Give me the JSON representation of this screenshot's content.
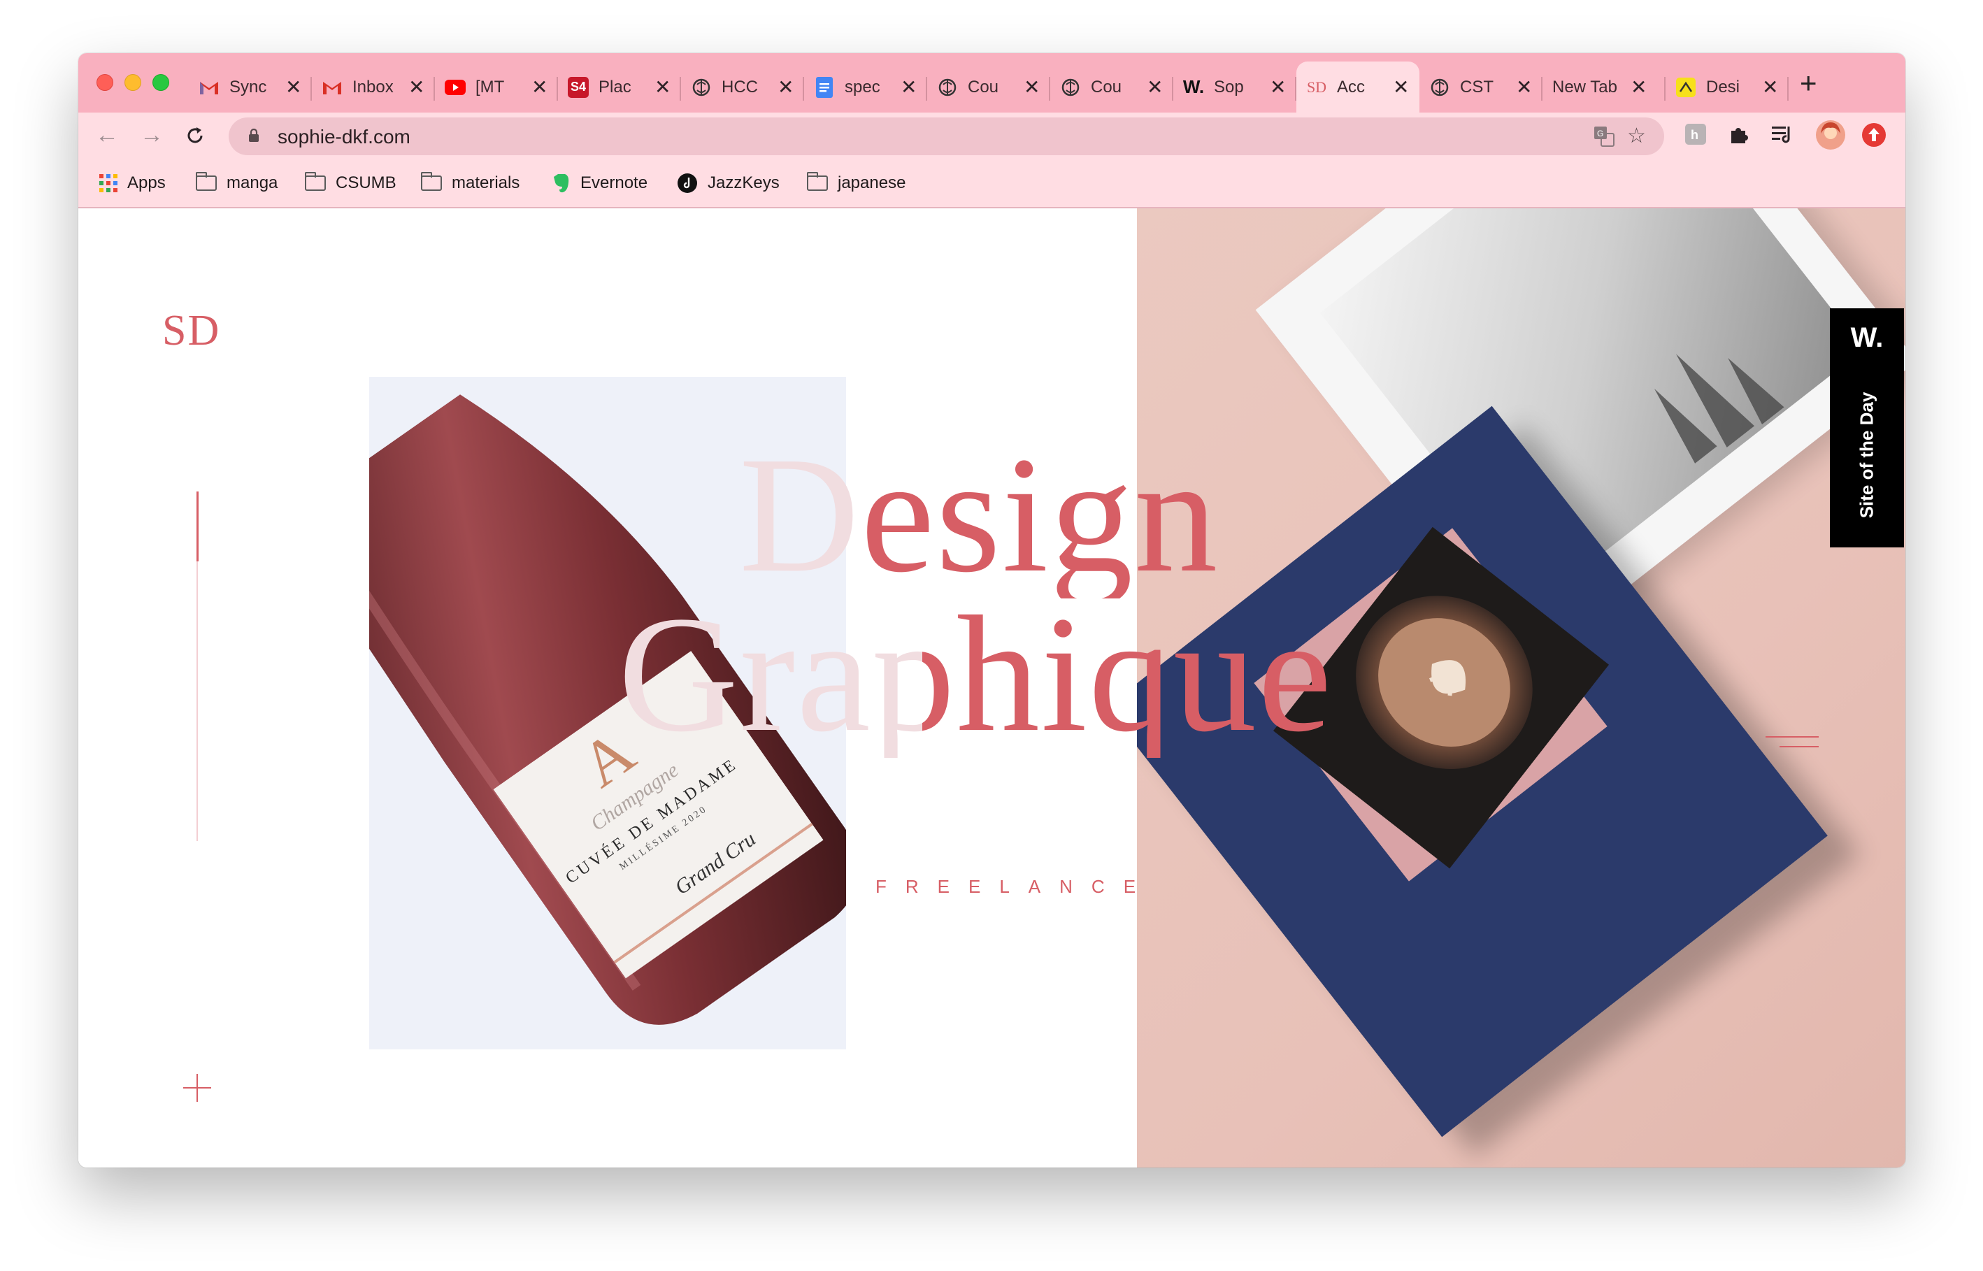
{
  "browser": {
    "tabs": [
      {
        "favicon": "gmail-icon",
        "title": "Sync"
      },
      {
        "favicon": "gmail-icon",
        "title": "Inbox"
      },
      {
        "favicon": "youtube-icon",
        "title": "[MT"
      },
      {
        "favicon": "s4-icon",
        "title": "Plac"
      },
      {
        "favicon": "brain-icon",
        "title": "HCC"
      },
      {
        "favicon": "docs-icon",
        "title": "spec"
      },
      {
        "favicon": "brain-icon",
        "title": "Cou"
      },
      {
        "favicon": "brain-icon",
        "title": "Cou"
      },
      {
        "favicon": "awwwards-icon",
        "title": "Sop"
      },
      {
        "favicon": "sd-icon",
        "title": "Acc",
        "active": true
      },
      {
        "favicon": "brain-icon",
        "title": "CST"
      },
      {
        "favicon": "",
        "title": "New Tab"
      },
      {
        "favicon": "design-icon",
        "title": "Desi"
      }
    ],
    "url": "sophie-dkf.com",
    "bookmarks": [
      {
        "icon": "apps-grid-icon",
        "label": "Apps"
      },
      {
        "icon": "folder-icon",
        "label": "manga"
      },
      {
        "icon": "folder-icon",
        "label": "CSUMB"
      },
      {
        "icon": "folder-icon",
        "label": "materials"
      },
      {
        "icon": "evernote-icon",
        "label": "Evernote"
      },
      {
        "icon": "jazzkeys-icon",
        "label": "JazzKeys"
      },
      {
        "icon": "folder-icon",
        "label": "japanese"
      }
    ],
    "accent_color": "#f9b0bf"
  },
  "page": {
    "logo": "SD",
    "headline_line1": "Design",
    "headline_line2": "Graphique",
    "tagline": "FREELANCE",
    "badge_mark": "W.",
    "badge_label": "Site of the Day",
    "brand_color": "#d75e65",
    "bottle_label": {
      "letter": "A",
      "script": "Champagne",
      "name": "CUVÉE DE MADAME",
      "vintage": "MILLÉSIME 2020",
      "signature": "Grand Cru"
    }
  }
}
